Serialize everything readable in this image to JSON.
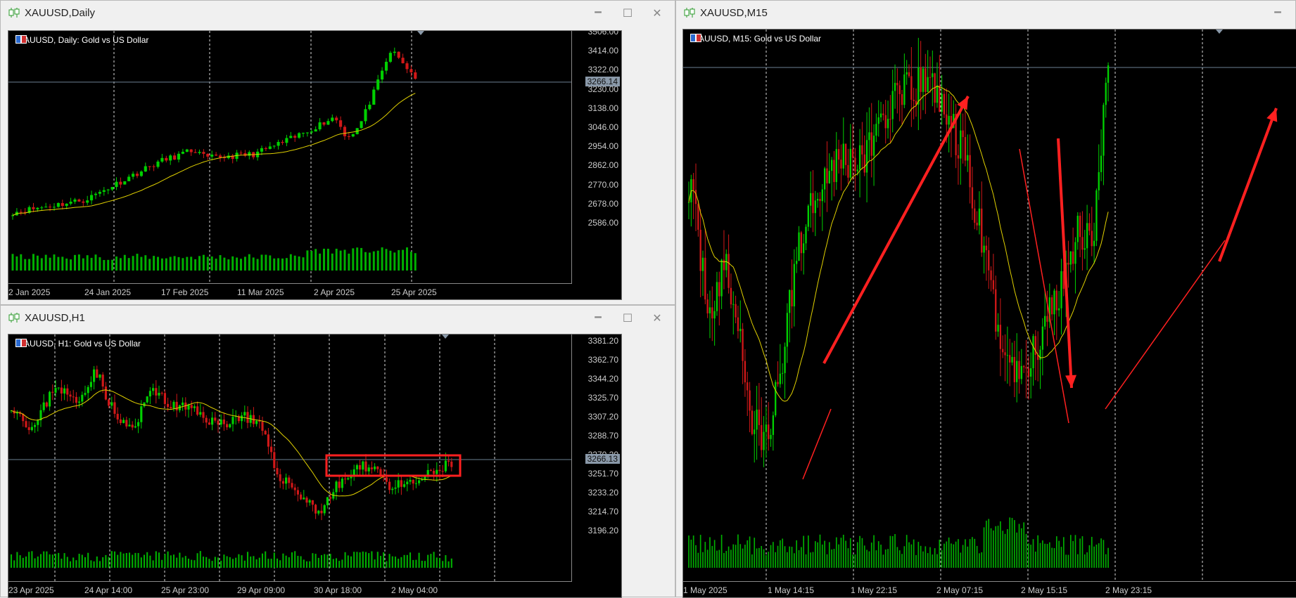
{
  "windows": [
    {
      "id": "daily",
      "title": "XAUUSD,Daily",
      "header": "XAUUSD, Daily:  Gold vs US Dollar",
      "price_labels": [
        "3506.00",
        "3414.00",
        "3322.00",
        "3230.00",
        "3138.00",
        "3046.00",
        "2954.00",
        "2862.00",
        "2770.00",
        "2678.00",
        "2586.00"
      ],
      "current_price": "3266.14",
      "time_labels": [
        "2 Jan 2025",
        "24 Jan 2025",
        "17 Feb 2025",
        "11 Mar 2025",
        "2 Apr 2025",
        "25 Apr 2025"
      ]
    },
    {
      "id": "h1",
      "title": "XAUUSD,H1",
      "header": "XAUUSD, H1:  Gold vs US Dollar",
      "price_labels": [
        "3381.20",
        "3362.70",
        "3344.20",
        "3325.70",
        "3307.20",
        "3288.70",
        "3270.20",
        "3251.70",
        "3233.20",
        "3214.70",
        "3196.20"
      ],
      "current_price": "3266.13",
      "time_labels": [
        "23 Apr 2025",
        "24 Apr 14:00",
        "25 Apr 23:00",
        "29 Apr 09:00",
        "30 Apr 18:00",
        "2 May 04:00"
      ]
    },
    {
      "id": "m15",
      "title": "XAUUSD,M15",
      "header": "XAUUSD, M15:  Gold vs US Dollar",
      "time_labels": [
        "1 May 2025",
        "1 May 14:15",
        "1 May 22:15",
        "2 May 07:15",
        "2 May 15:15",
        "2 May 23:15"
      ]
    }
  ],
  "controls": {
    "minimize": "🗕",
    "maximize": "☐",
    "close": "✕"
  },
  "colors": {
    "bull": "#00d000",
    "bear": "#d01818",
    "ma": "#e0d000",
    "volume": "#00b000",
    "grid": "#d8d8d8",
    "annotation": "#ff2020"
  }
}
